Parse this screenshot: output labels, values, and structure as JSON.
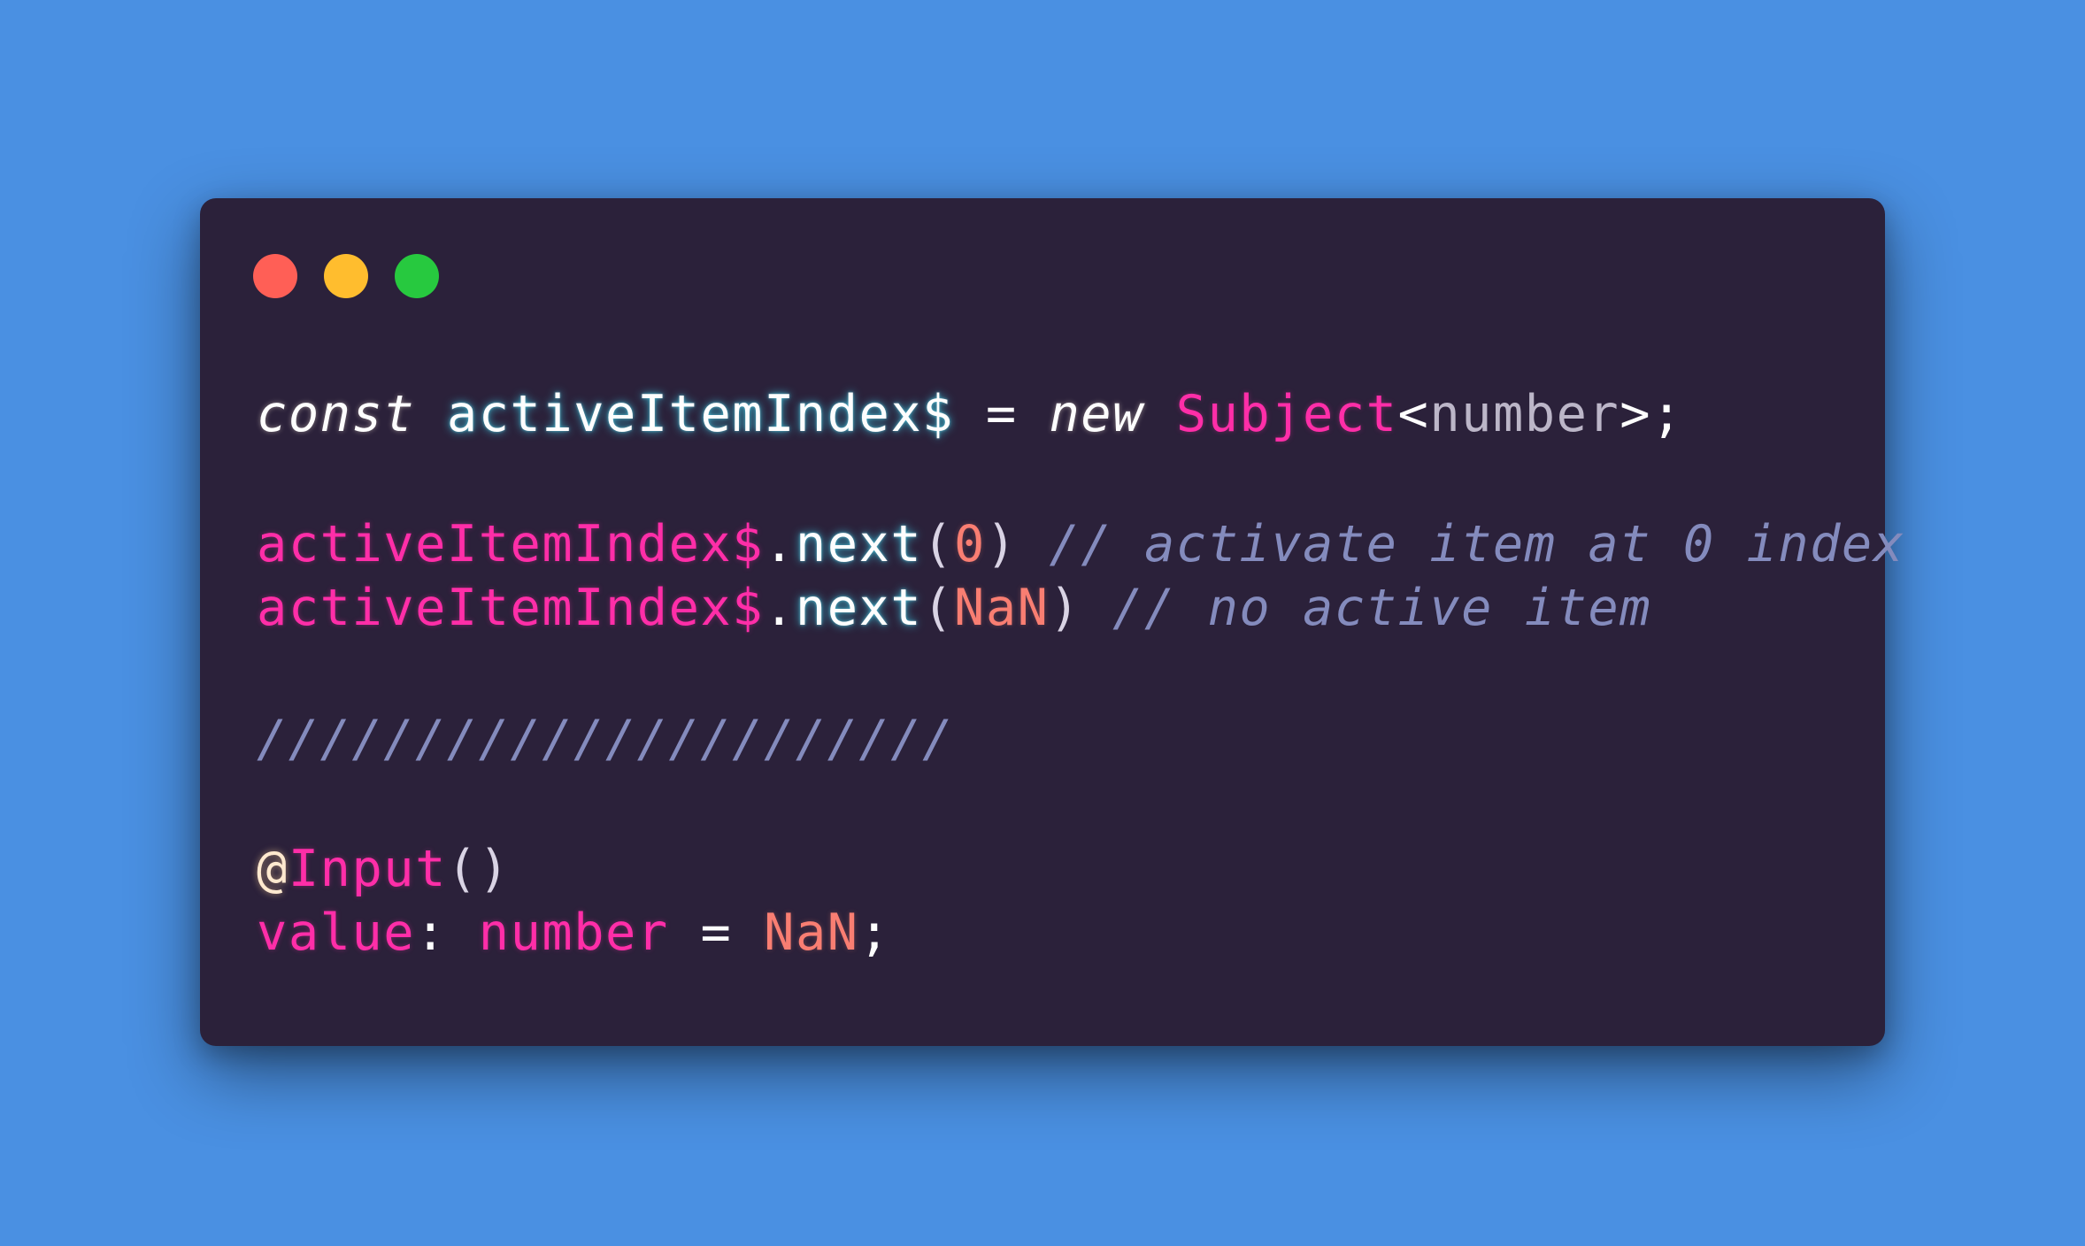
{
  "window": {
    "controls": [
      "close",
      "minimize",
      "maximize"
    ],
    "colors": {
      "close": "#ff5f56",
      "minimize": "#ffbd2e",
      "maximize": "#27c93f",
      "background": "#2b213a",
      "page_background": "#4a90e2"
    }
  },
  "code": {
    "line1": {
      "kw_const": "const",
      "identifier": "activeItemIndex$",
      "op_eq": "=",
      "kw_new": "new",
      "class_name": "Subject",
      "lt": "<",
      "type_param": "number",
      "gt_semi": ">;"
    },
    "line2": {
      "identifier": "activeItemIndex$",
      "dot": ".",
      "method": "next",
      "open": "(",
      "arg": "0",
      "close": ")",
      "comment": "// activate item at 0 index"
    },
    "line3": {
      "identifier": "activeItemIndex$",
      "dot": ".",
      "method": "next",
      "open": "(",
      "arg": "NaN",
      "close": ")",
      "comment": "// no active item"
    },
    "line4": {
      "separator": "//////////////////////"
    },
    "line5": {
      "at": "@",
      "decorator": "Input",
      "parens": "()"
    },
    "line6": {
      "prop": "value",
      "colon": ":",
      "type": "number",
      "op_eq": "=",
      "value": "NaN",
      "semi": ";"
    }
  }
}
